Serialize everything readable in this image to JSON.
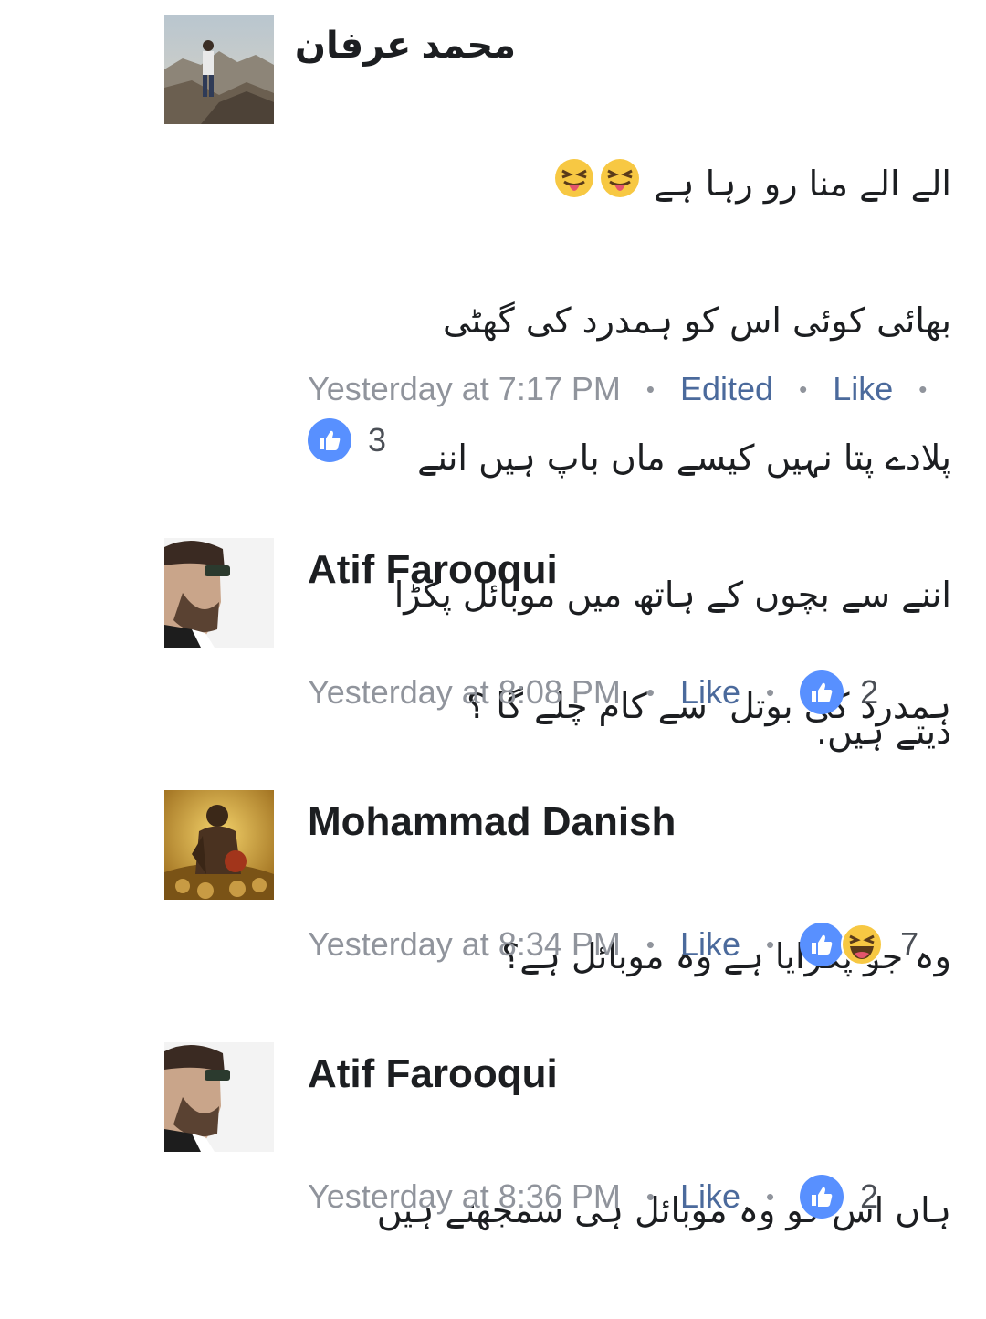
{
  "comments": [
    {
      "author": "محمد عرفان",
      "lines": [
        "الے الے منا رو رہا ہے",
        "بھائی کوئی اس کو ہمدرد کی گھٹی",
        "پلادے پتا نہیں کیسے ماں باپ ہیں اننے",
        "اننے سے بچوں کے ہاتھ میں موبائل پکڑا",
        "دیتے ہیں."
      ],
      "emoji_first_line": [
        "squinting-tongue-emoji",
        "squinting-tongue-emoji"
      ],
      "timestamp": "Yesterday at 7:17 PM",
      "edited_label": "Edited",
      "like_label": "Like",
      "reaction_count": "3",
      "reactions": [
        "like"
      ]
    },
    {
      "author": "Atif Farooqui",
      "lines": [
        "ہمدرد کی بوتل  سے کام چلے گا ؟"
      ],
      "timestamp": "Yesterday at 8:08 PM",
      "like_label": "Like",
      "reaction_count": "2",
      "reactions": [
        "like"
      ]
    },
    {
      "author": "Mohammad Danish",
      "lines": [
        "وہ جو پکڑایا ہے وہ موبائل ہے؟"
      ],
      "timestamp": "Yesterday at 8:34 PM",
      "like_label": "Like",
      "reaction_count": "7",
      "reactions": [
        "like",
        "haha"
      ]
    },
    {
      "author": "Atif Farooqui",
      "lines": [
        "ہاں اس کو وہ موبائل ہی سمجھتے ہیں"
      ],
      "timestamp": "Yesterday at 8:36 PM",
      "like_label": "Like",
      "reaction_count": "2",
      "reactions": [
        "like"
      ]
    }
  ],
  "colors": {
    "timestamp": "#90949c",
    "link": "#4b6a9c",
    "like_blue": "#5890ff",
    "text": "#1c1e21"
  }
}
